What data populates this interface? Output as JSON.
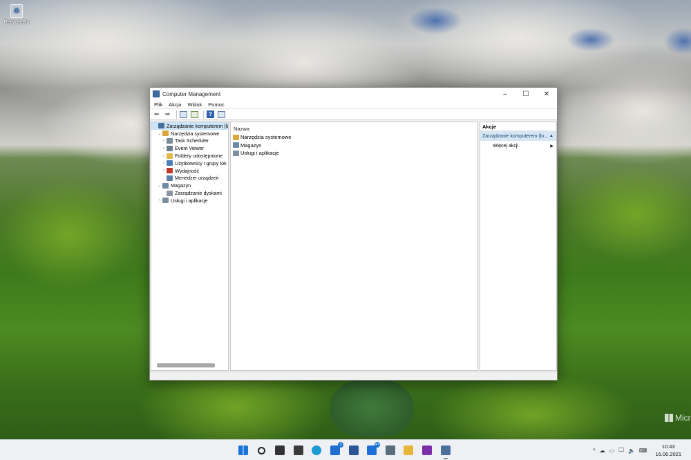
{
  "desktop": {
    "recycle_bin_label": "Recycle Bin",
    "watermark": "Micr"
  },
  "window": {
    "title": "Computer Management",
    "controls": {
      "minimize": "–",
      "maximize": "☐",
      "close": "✕"
    },
    "menu": [
      "Plik",
      "Akcja",
      "Widok",
      "Pomoc"
    ],
    "tree": [
      {
        "label": "Zarządzanie komputerem (lokal",
        "chevron": "",
        "selected": true,
        "indent": 0,
        "icon_color": "#4a6f9a"
      },
      {
        "label": "Narzędzia systemowe",
        "chevron": "⌄",
        "indent": 1,
        "icon_color": "#d9a73a"
      },
      {
        "label": "Task Scheduler",
        "chevron": "›",
        "indent": 2,
        "icon_color": "#7c8c99"
      },
      {
        "label": "Event Viewer",
        "chevron": "›",
        "indent": 2,
        "icon_color": "#6b7d8f"
      },
      {
        "label": "Foldery udostępnione",
        "chevron": "›",
        "indent": 2,
        "icon_color": "#e3b84a"
      },
      {
        "label": "Użytkownicy i grupy lok",
        "chevron": "›",
        "indent": 2,
        "icon_color": "#4f7fb8"
      },
      {
        "label": "Wydajność",
        "chevron": "›",
        "indent": 2,
        "icon_color": "#c0392b"
      },
      {
        "label": "Menedżer urządzeń",
        "chevron": "",
        "indent": 2,
        "icon_color": "#5b7fa8"
      },
      {
        "label": "Magazyn",
        "chevron": "⌄",
        "indent": 1,
        "icon_color": "#6d8aa8"
      },
      {
        "label": "Zarządzanie dyskami",
        "chevron": "",
        "indent": 2,
        "icon_color": "#8a96a3"
      },
      {
        "label": "Usługi i aplikacje",
        "chevron": "›",
        "indent": 1,
        "icon_color": "#7d8ea0"
      }
    ],
    "content": {
      "column_header": "Nazwa",
      "items": [
        {
          "label": "Narzędzia systemowe",
          "icon_color": "#d9a73a"
        },
        {
          "label": "Magazyn",
          "icon_color": "#6d8aa8"
        },
        {
          "label": "Usługi i aplikacje",
          "icon_color": "#7d8ea0"
        }
      ]
    },
    "actions": {
      "header": "Akcje",
      "section": "Zarządzanie komputerem (lo...",
      "more_actions": "Więcej akcji"
    }
  },
  "taskbar": {
    "apps": [
      {
        "name": "start-icon",
        "color": "#1a73d9"
      },
      {
        "name": "search-icon",
        "color": "#222222"
      },
      {
        "name": "task-view-icon",
        "color": "#333333"
      },
      {
        "name": "widgets-icon",
        "color": "#3a3a3a"
      },
      {
        "name": "edge-icon",
        "color": "#1b9ad6"
      },
      {
        "name": "mail-icon",
        "color": "#1f6fd1",
        "badge": "3"
      },
      {
        "name": "word-icon",
        "color": "#2b5797"
      },
      {
        "name": "notifications-app-icon",
        "color": "#1e6fd9",
        "badge": "47"
      },
      {
        "name": "calculator-icon",
        "color": "#5b6d7c"
      },
      {
        "name": "file-explorer-icon",
        "color": "#e7b53a"
      },
      {
        "name": "onenote-icon",
        "color": "#7b2fa8"
      },
      {
        "name": "computer-management-icon",
        "color": "#4a6f9a",
        "running": true
      }
    ],
    "tray": {
      "chevron": "^",
      "clock_time": "10:43",
      "clock_date": "16.06.2021"
    }
  }
}
